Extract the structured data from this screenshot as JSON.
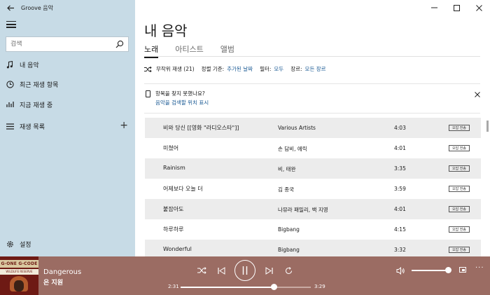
{
  "window": {
    "title": "Groove 음악"
  },
  "sidebar": {
    "search_placeholder": "검색",
    "nav": [
      {
        "label": "내 음악",
        "icon": "music-note-icon"
      },
      {
        "label": "최근 재생 항목",
        "icon": "clock-icon"
      },
      {
        "label": "지금 재생 중",
        "icon": "now-playing-icon"
      },
      {
        "label": "재생 목록",
        "icon": "playlist-icon"
      }
    ],
    "settings_label": "설정"
  },
  "main": {
    "title": "내 음악",
    "tabs": [
      {
        "label": "노래",
        "active": true
      },
      {
        "label": "아티스트",
        "active": false
      },
      {
        "label": "앨범",
        "active": false
      }
    ],
    "filterbar": {
      "shuffle_label": "무작위 재생 (21)",
      "sort_label": "정렬 기준:",
      "sort_value": "추가된 날짜",
      "filter_label": "필터:",
      "filter_value": "모두",
      "genre_label": "장르:",
      "genre_value": "모든 장르"
    },
    "notice": {
      "question": "항목을 찾지 못했나요?",
      "link": "음악을 검색할 위치 표시"
    },
    "songs": [
      {
        "title": "비와 당신 [[영화 \"라디오스타\"]]",
        "artist": "Various Artists",
        "duration": "4:03",
        "badge": "오답 전송"
      },
      {
        "title": "미쳤어",
        "artist": "손 담비, 에릭",
        "duration": "4:01",
        "badge": "오답 전송"
      },
      {
        "title": "Rainism",
        "artist": "비, 태완",
        "duration": "3:35",
        "badge": "오답 전송"
      },
      {
        "title": "어제보다 오늘 더",
        "artist": "김 종국",
        "duration": "3:59",
        "badge": "오답 전송"
      },
      {
        "title": "붙잡아도",
        "artist": "나뮤라 패밀리, 백 지영",
        "duration": "4:01",
        "badge": "오답 전송"
      },
      {
        "title": "하루하루",
        "artist": "Bigbang",
        "duration": "4:15",
        "badge": "오답 전송"
      },
      {
        "title": "Wonderful",
        "artist": "Bigbang",
        "duration": "3:32",
        "badge": "오답 전송"
      }
    ]
  },
  "player": {
    "track_title": "Dangerous",
    "track_artist": "은 지원",
    "album_art_text": "G-ONE G-CODE",
    "album_art_subtext": "WILDLIFE RESERVE",
    "time_current": "2:31",
    "time_total": "3:29",
    "progress_fraction": 0.72,
    "volume_fraction": 1.0
  },
  "colors": {
    "sidebar_bg": "#c7dbe6",
    "player_bg": "#9b6c63",
    "link": "#1a5a94"
  }
}
